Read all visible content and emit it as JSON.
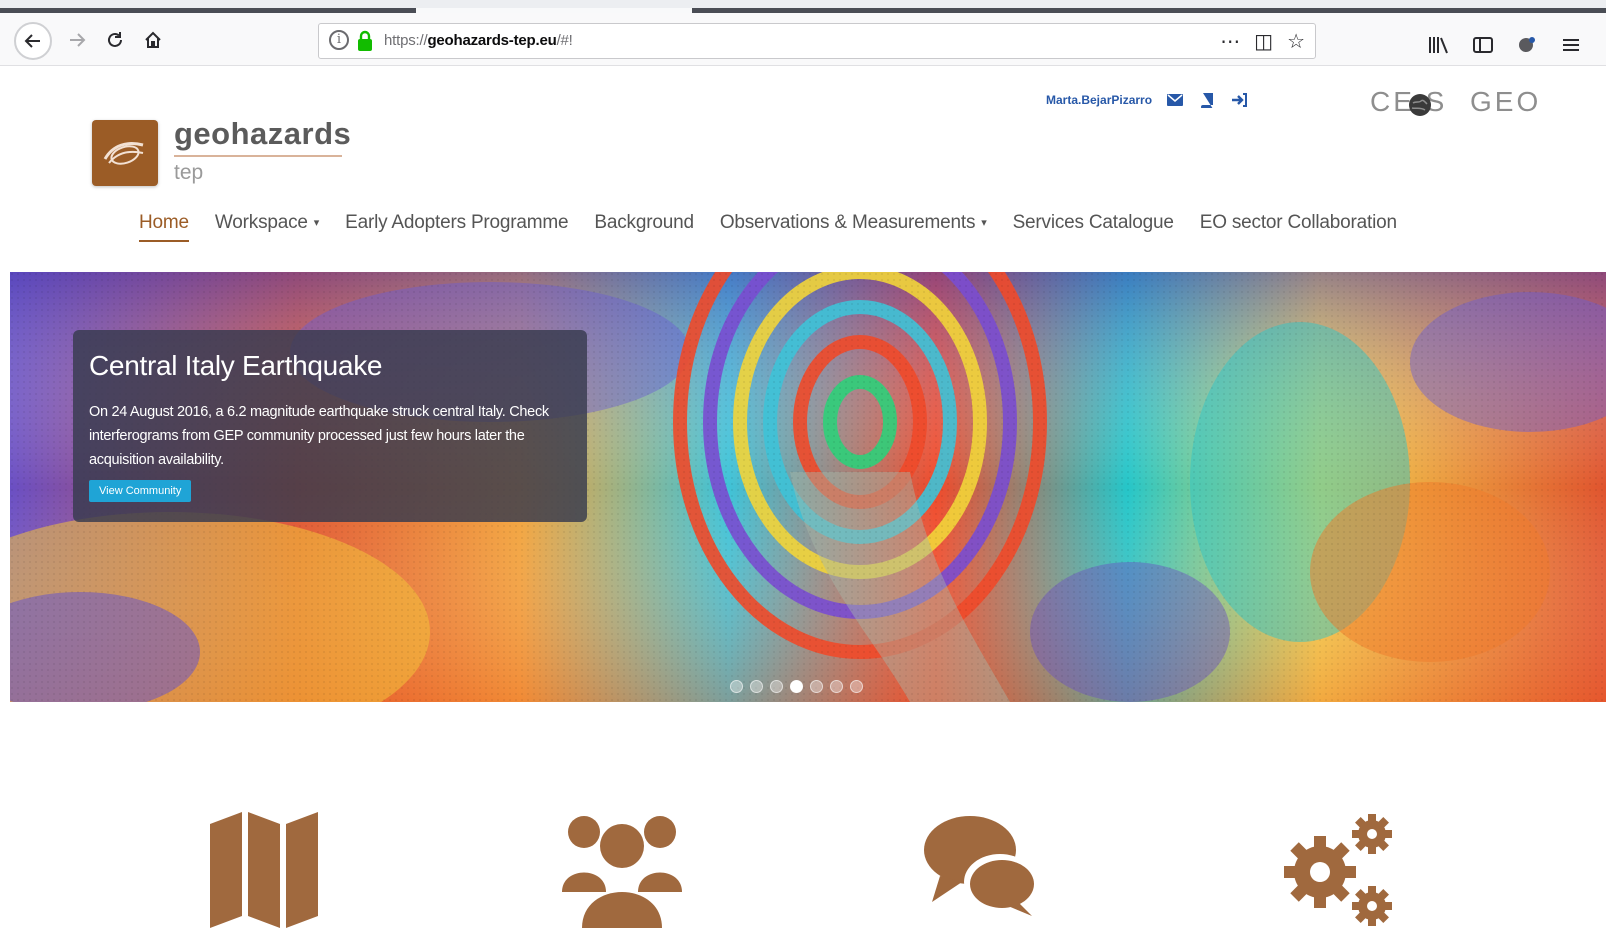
{
  "browser": {
    "url_prefix": "https://",
    "url_domain": "geohazards-tep.eu",
    "url_suffix": "/#!",
    "info_glyph": "i",
    "page_actions": [
      "⋯",
      "◫",
      "☆"
    ],
    "toolbar_icons": [
      "library-icon",
      "sidebar-icon",
      "extension-icon",
      "menu-icon"
    ]
  },
  "site": {
    "logo_title": "geohazards",
    "logo_subtitle": "tep",
    "user_name": "Marta.BejarPizarro",
    "partners": {
      "ceos": "CE   S",
      "geo": "GEO"
    }
  },
  "menu": [
    {
      "label": "Home",
      "active": true,
      "dropdown": false
    },
    {
      "label": "Workspace",
      "active": false,
      "dropdown": true
    },
    {
      "label": "Early Adopters Programme",
      "active": false,
      "dropdown": false
    },
    {
      "label": "Background",
      "active": false,
      "dropdown": false
    },
    {
      "label": "Observations & Measurements",
      "active": false,
      "dropdown": true
    },
    {
      "label": "Services Catalogue",
      "active": false,
      "dropdown": false
    },
    {
      "label": "EO sector Collaboration",
      "active": false,
      "dropdown": false
    }
  ],
  "hero": {
    "title": "Central Italy Earthquake",
    "text": "On 24 August 2016, a 6.2 magnitude earthquake struck central Italy. Check interferograms from GEP community processed just few hours later the acquisition availability.",
    "button_label": "View Community",
    "slides_total": 7,
    "slide_active": 4
  },
  "features": [
    "map-icon",
    "community-icon",
    "chat-icon",
    "gears-icon"
  ],
  "colors": {
    "brand": "#9b5c26",
    "link": "#2758a8",
    "button": "#1fa4d6"
  }
}
